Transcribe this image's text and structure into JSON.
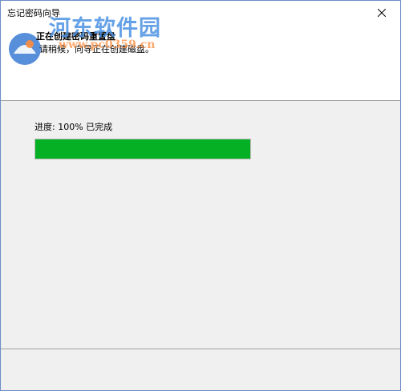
{
  "window": {
    "title": "忘记密码向导"
  },
  "header": {
    "title": "正在创建密码重置盘",
    "subtitle": "请稍候，向导正在创建磁盘。"
  },
  "watermark": {
    "site": "河东软件园",
    "url": "www.pc0359.cn"
  },
  "progress": {
    "label": "进度: 100% 已完成",
    "value": 1.0
  },
  "icons": {
    "close": "close-icon",
    "logo": "watermark-logo"
  },
  "colors": {
    "progress_fill": "#06b025",
    "window_border": "#6b8ec6",
    "watermark_text": "#4a90e2",
    "watermark_url": "#ff8c3c"
  }
}
